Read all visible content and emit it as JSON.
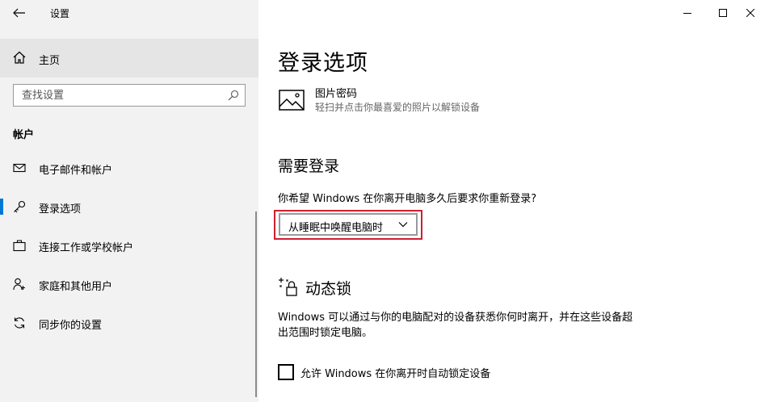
{
  "app": {
    "title": "设置"
  },
  "sidebar": {
    "home_label": "主页",
    "search_placeholder": "查找设置",
    "section_label": "帐户",
    "items": [
      {
        "label": "电子邮件和帐户",
        "icon": "mail-icon"
      },
      {
        "label": "登录选项",
        "icon": "key-icon",
        "active": true
      },
      {
        "label": "连接工作或学校帐户",
        "icon": "briefcase-icon"
      },
      {
        "label": "家庭和其他用户",
        "icon": "person-icon"
      },
      {
        "label": "同步你的设置",
        "icon": "sync-icon"
      }
    ]
  },
  "content": {
    "page_title": "登录选项",
    "picture_password": {
      "title": "图片密码",
      "description": "轻扫并点击你最喜爱的照片以解锁设备"
    },
    "require_signin": {
      "heading": "需要登录",
      "question": "你希望 Windows 在你离开电脑多久后要求你重新登录?",
      "dropdown_value": "从睡眠中唤醒电脑时"
    },
    "dynamic_lock": {
      "heading": "动态锁",
      "description": "Windows 可以通过与你的电脑配对的设备获悉你何时离开，并在这些设备超出范围时锁定电脑。",
      "checkbox_label": "允许 Windows 在你离开时自动锁定设备",
      "checkbox_checked": false
    }
  },
  "colors": {
    "accent": "#0078d7",
    "highlight": "#d01f2f",
    "sidebar_bg": "#f2f2f2"
  }
}
